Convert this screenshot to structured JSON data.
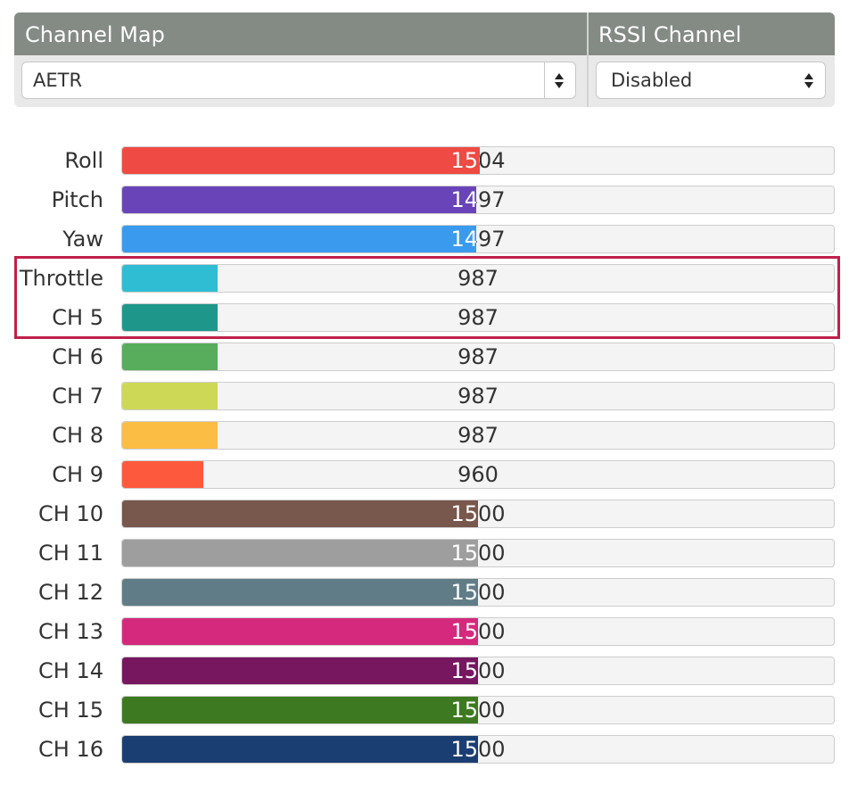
{
  "header": {
    "channel_map_title": "Channel Map",
    "rssi_channel_title": "RSSI Channel"
  },
  "channel_map_select": {
    "value": "AETR"
  },
  "rssi_select": {
    "value": "Disabled"
  },
  "value_range": {
    "min": 800,
    "max": 2200
  },
  "channels": [
    {
      "label": "Roll",
      "value": 1504,
      "color": "#ef4a43"
    },
    {
      "label": "Pitch",
      "value": 1497,
      "color": "#6944b8"
    },
    {
      "label": "Yaw",
      "value": 1497,
      "color": "#3a9bee"
    },
    {
      "label": "Throttle",
      "value": 987,
      "color": "#2fbdd4"
    },
    {
      "label": "CH 5",
      "value": 987,
      "color": "#1e978a"
    },
    {
      "label": "CH 6",
      "value": 987,
      "color": "#57ad5b"
    },
    {
      "label": "CH 7",
      "value": 987,
      "color": "#cdd956"
    },
    {
      "label": "CH 8",
      "value": 987,
      "color": "#fbbd44"
    },
    {
      "label": "CH 9",
      "value": 960,
      "color": "#fd5a3d"
    },
    {
      "label": "CH 10",
      "value": 1500,
      "color": "#78574c"
    },
    {
      "label": "CH 11",
      "value": 1500,
      "color": "#9e9e9e"
    },
    {
      "label": "CH 12",
      "value": 1500,
      "color": "#607d87"
    },
    {
      "label": "CH 13",
      "value": 1500,
      "color": "#d4297d"
    },
    {
      "label": "CH 14",
      "value": 1500,
      "color": "#761760"
    },
    {
      "label": "CH 15",
      "value": 1500,
      "color": "#3d7920"
    },
    {
      "label": "CH 16",
      "value": 1500,
      "color": "#1a3d72"
    }
  ],
  "highlight_color": "#c0204a"
}
